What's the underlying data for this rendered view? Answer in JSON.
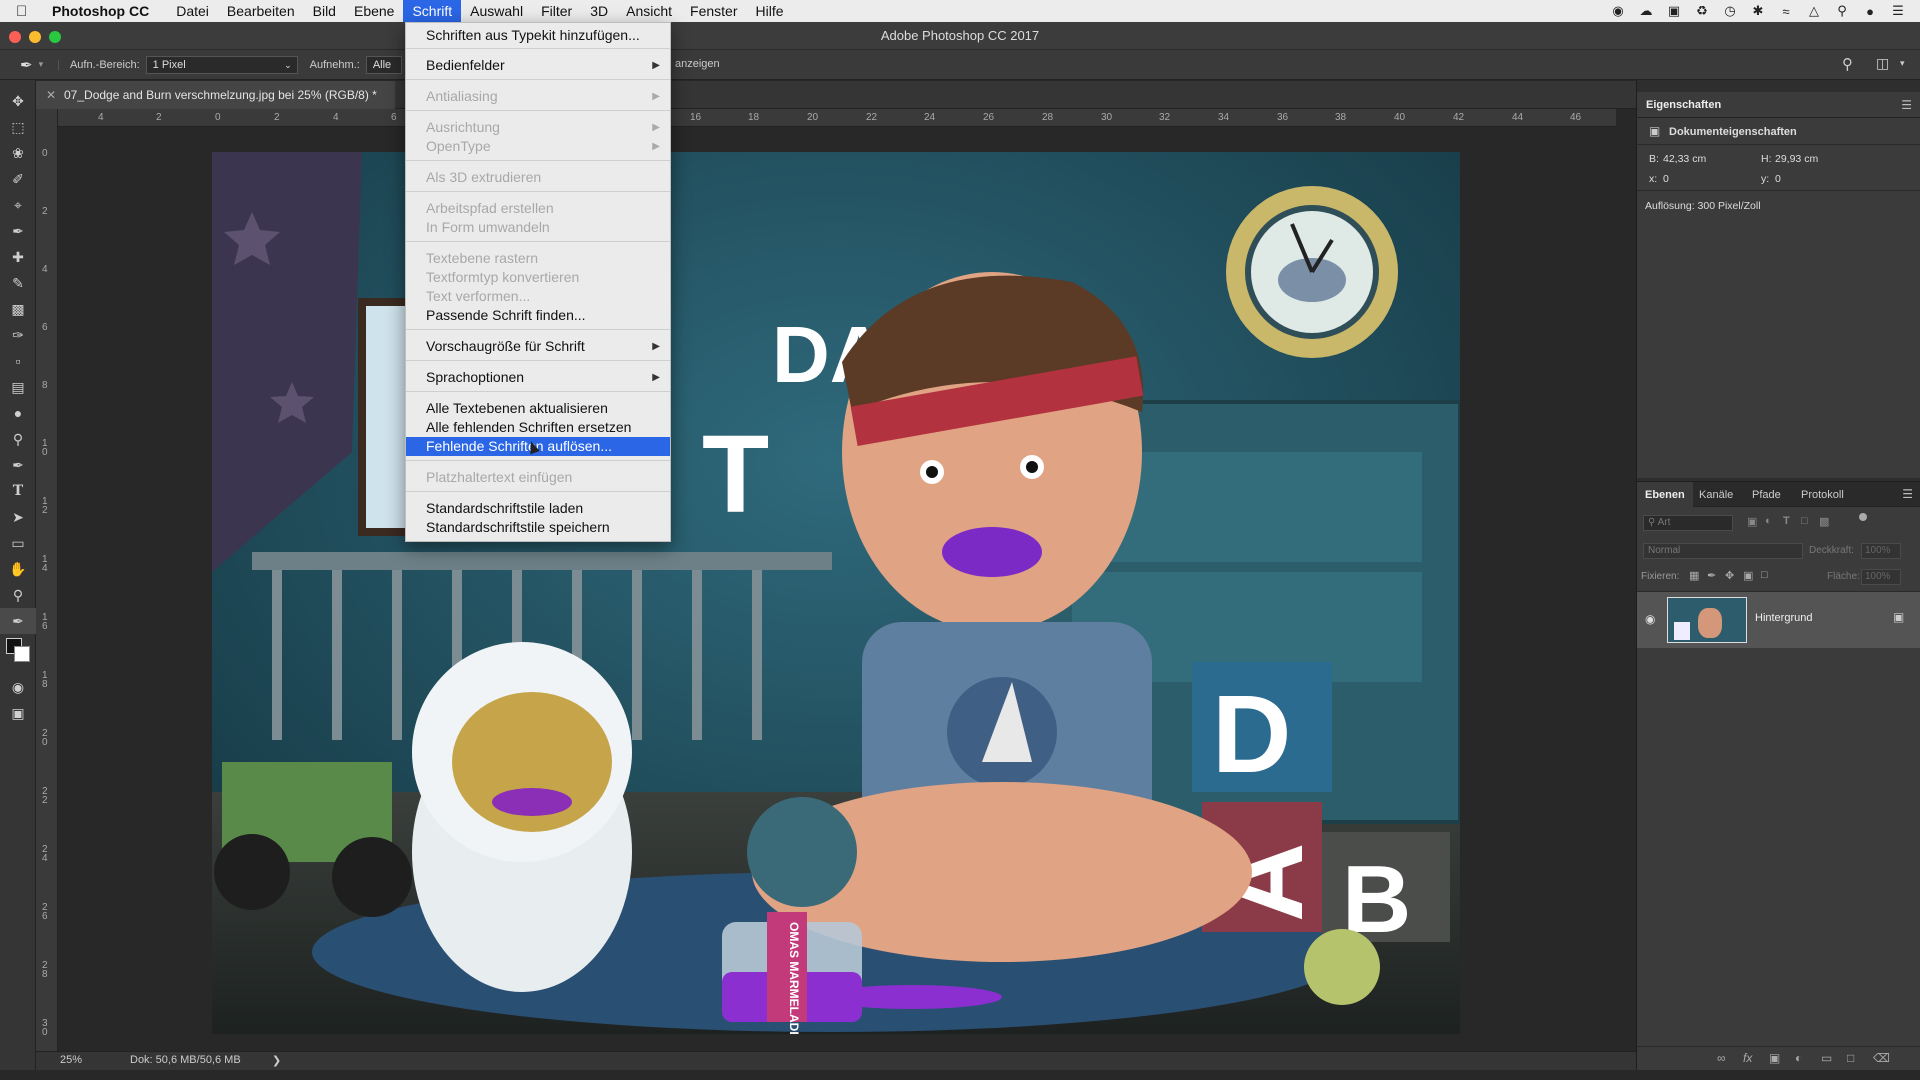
{
  "menubar": {
    "app": "Photoshop CC",
    "items": [
      "Datei",
      "Bearbeiten",
      "Bild",
      "Ebene",
      "Schrift",
      "Auswahl",
      "Filter",
      "3D",
      "Ansicht",
      "Fenster",
      "Hilfe"
    ]
  },
  "window": {
    "title": "Adobe Photoshop CC 2017"
  },
  "options": {
    "range_label": "Aufn.-Bereich:",
    "range_value": "1 Pixel",
    "sample_label": "Aufnehm.:",
    "sample_value": "Alle Eb",
    "show_label": "anzeigen"
  },
  "document": {
    "tab_title": "07_Dodge and Burn verschmelzung.jpg bei 25% (RGB/8) *",
    "zoom": "25%",
    "doc_size": "Dok: 50,6 MB/50,6 MB"
  },
  "ruler": {
    "h_ticks": [
      "4",
      "2",
      "0",
      "2",
      "4",
      "6",
      "16",
      "18",
      "20",
      "22",
      "24",
      "26",
      "28",
      "30",
      "32",
      "34",
      "36",
      "38",
      "40",
      "42",
      "44",
      "46"
    ],
    "v_ticks": [
      "0",
      "2",
      "4",
      "6",
      "8",
      "10",
      "12",
      "14",
      "16",
      "18",
      "20",
      "22",
      "24",
      "26",
      "28",
      "30"
    ]
  },
  "schrift_menu": {
    "items": [
      {
        "label": "Schriften aus Typekit hinzufügen...",
        "disabled": false
      },
      {
        "label": "Bedienfelder",
        "disabled": false,
        "submenu": true
      },
      {
        "label": "Antialiasing",
        "disabled": true,
        "submenu": true
      },
      {
        "label": "Ausrichtung",
        "disabled": true,
        "submenu": true
      },
      {
        "label": "OpenType",
        "disabled": true,
        "submenu": true
      },
      {
        "label": "Als 3D extrudieren",
        "disabled": true
      },
      {
        "label": "Arbeitspfad erstellen",
        "disabled": true
      },
      {
        "label": "In Form umwandeln",
        "disabled": true
      },
      {
        "label": "Textebene rastern",
        "disabled": true
      },
      {
        "label": "Textformtyp konvertieren",
        "disabled": true
      },
      {
        "label": "Text verformen...",
        "disabled": true
      },
      {
        "label": "Passende Schrift finden...",
        "disabled": false
      },
      {
        "label": "Vorschaugröße für Schrift",
        "disabled": false,
        "submenu": true
      },
      {
        "label": "Sprachoptionen",
        "disabled": false,
        "submenu": true
      },
      {
        "label": "Alle Textebenen aktualisieren",
        "disabled": false
      },
      {
        "label": "Alle fehlenden Schriften ersetzen",
        "disabled": false
      },
      {
        "label": "Fehlende Schriften auflösen...",
        "disabled": false,
        "highlighted": true
      },
      {
        "label": "Platzhaltertext einfügen",
        "disabled": true
      },
      {
        "label": "Standardschriftstile laden",
        "disabled": false
      },
      {
        "label": "Standardschriftstile speichern",
        "disabled": false
      }
    ]
  },
  "properties_panel": {
    "title": "Eigenschaften",
    "subtitle": "Dokumenteigenschaften",
    "width_label": "B:",
    "width_value": "42,33 cm",
    "height_label": "H:",
    "height_value": "29,93 cm",
    "x_label": "x:",
    "x_value": "0",
    "y_label": "y:",
    "y_value": "0",
    "resolution": "Auflösung: 300 Pixel/Zoll"
  },
  "layers_panel": {
    "tabs": [
      "Ebenen",
      "Kanäle",
      "Pfade",
      "Protokoll"
    ],
    "search_placeholder": "Art",
    "blend_mode": "Normal",
    "opacity_label": "Deckkraft:",
    "opacity_value": "100%",
    "lock_label": "Fixieren:",
    "fill_label": "Fläche:",
    "fill_value": "100%",
    "layer_name": "Hintergrund"
  },
  "artwork": {
    "letters": [
      "DA",
      "T",
      "D",
      "A",
      "B"
    ],
    "jar_label": "OMAS MARMELADE"
  },
  "colors": {
    "accent": "#2a66e6",
    "menu_bg": "#ecebeb",
    "panel_bg": "#2e2e2e"
  }
}
